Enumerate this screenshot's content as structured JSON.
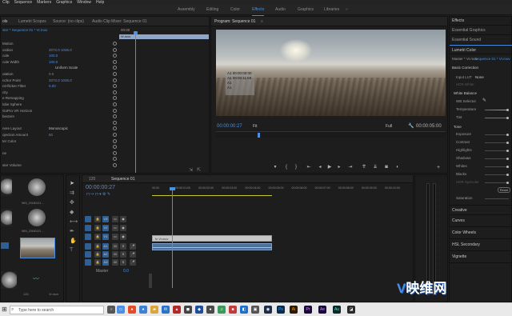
{
  "menu": [
    "Clip",
    "Sequence",
    "Markers",
    "Graphics",
    "Window",
    "Help"
  ],
  "workspaces": [
    "Assembly",
    "Editing",
    "Color",
    "Effects",
    "Audio",
    "Graphics",
    "Libraries"
  ],
  "active_workspace": "Effects",
  "source_panel": {
    "tabs": [
      "ols",
      "Lumetri Scopes",
      "Source: (no clips)",
      "Audio Clip Mixer: Sequence 01"
    ],
    "active_tab": "ols",
    "master": "ster * Sequence 01 * Vr.mov",
    "timecode": "00:00",
    "clip_name": "Vr.mov",
    "rows": [
      {
        "label": "Motion",
        "value": ""
      },
      {
        "label": "osition",
        "value": "2072.0    1036.0"
      },
      {
        "label": "cale",
        "value": "100.0"
      },
      {
        "label": "cale Width",
        "value": "100.0"
      },
      {
        "label": "",
        "value": "Uniform Scale"
      },
      {
        "label": "otation",
        "value": "0.0"
      },
      {
        "label": "nchor Point",
        "value": "2072.0    1036.0"
      },
      {
        "label": "nti-flicker Filter",
        "value": "0.00"
      },
      {
        "label": "city",
        "value": ""
      },
      {
        "label": "e Remapping",
        "value": ""
      },
      {
        "label": "lobe Sphere",
        "value": ""
      },
      {
        "label": "GoPro VR Horizon",
        "value": ""
      },
      {
        "label": "bectern",
        "value": ""
      },
      {
        "label": "",
        "value": ""
      },
      {
        "label": "nere Layout",
        "value": "Monoscopic"
      },
      {
        "label": "ojection Amount",
        "value": "50"
      },
      {
        "label": "ter Color",
        "value": ""
      },
      {
        "label": "",
        "value": ""
      },
      {
        "label": "ne",
        "value": ""
      },
      {
        "label": "",
        "value": ""
      },
      {
        "label": "ster Volume",
        "value": ""
      }
    ]
  },
  "program": {
    "title": "Program: Sequence 01",
    "timecode_left": "00:00:00:27",
    "fit": "Fit",
    "quality": "Full",
    "timecode_right": "00:00:05:00",
    "overlay": [
      "A1 00:00:00:00",
      "A1 00:00:11:59",
      "A1",
      "A1"
    ]
  },
  "timeline": {
    "tabs": [
      "120",
      "Sequence 01"
    ],
    "timecode": "00:00:00:27",
    "ruler": [
      "00:00",
      "00:00:01:00",
      "00:00:02:00",
      "00:00:03:00",
      "00:00:04:00",
      "00:00:05:00",
      "00:00:06:00",
      "00:00:07:00",
      "00:00:08:00",
      "00:00:09:00",
      "00:00:10:00"
    ],
    "video_tracks": [
      "V3",
      "V2",
      "V1"
    ],
    "audio_tracks": [
      "A1",
      "A2",
      "A3"
    ],
    "clip_label": "fx Vr.mov",
    "master_label": "Master",
    "master_value": "0.0"
  },
  "project": {
    "items": [
      "",
      "WIN_20180131 ...",
      "",
      "WIN_20180131 ...",
      "",
      "",
      "",
      "",
      "",
      "120",
      "Vr.mov"
    ]
  },
  "lumetri": {
    "header": "Effects",
    "sections": [
      "Essential Graphics",
      "Essential Sound",
      "Lumetri Color"
    ],
    "master": "Master * Vr.mov",
    "sequence": "Sequence 01 * Vr.mov",
    "basic": "Basic Correction",
    "input_lut_label": "Input LUT",
    "input_lut_value": "None",
    "hdr_white": "HDR White",
    "white_balance": "White Balance",
    "wb_selector": "WB Selector",
    "temperature": "Temperature",
    "tint": "Tint",
    "tone": "Tone",
    "tone_rows": [
      "Exposure",
      "Contrast",
      "Highlights",
      "Shadows",
      "Whites",
      "Blacks",
      "HDR Specular"
    ],
    "reset": "Reset",
    "saturation": "Saturation",
    "creative": "Creative",
    "curves": "Curves",
    "color_wheels": "Color Wheels",
    "hsl": "HSL Secondary",
    "vignette": "Vignette"
  },
  "taskbar": {
    "search_placeholder": "Type here to search",
    "apps": [
      "Ps",
      "Ai",
      "Pr",
      "Ae",
      "Au"
    ]
  },
  "watermark": "映维网",
  "colors": {
    "accent": "#4d8fe0",
    "playhead": "#4d8fe0",
    "clip": "#c7c7c7",
    "audio_clip": "#5a7fb0"
  }
}
